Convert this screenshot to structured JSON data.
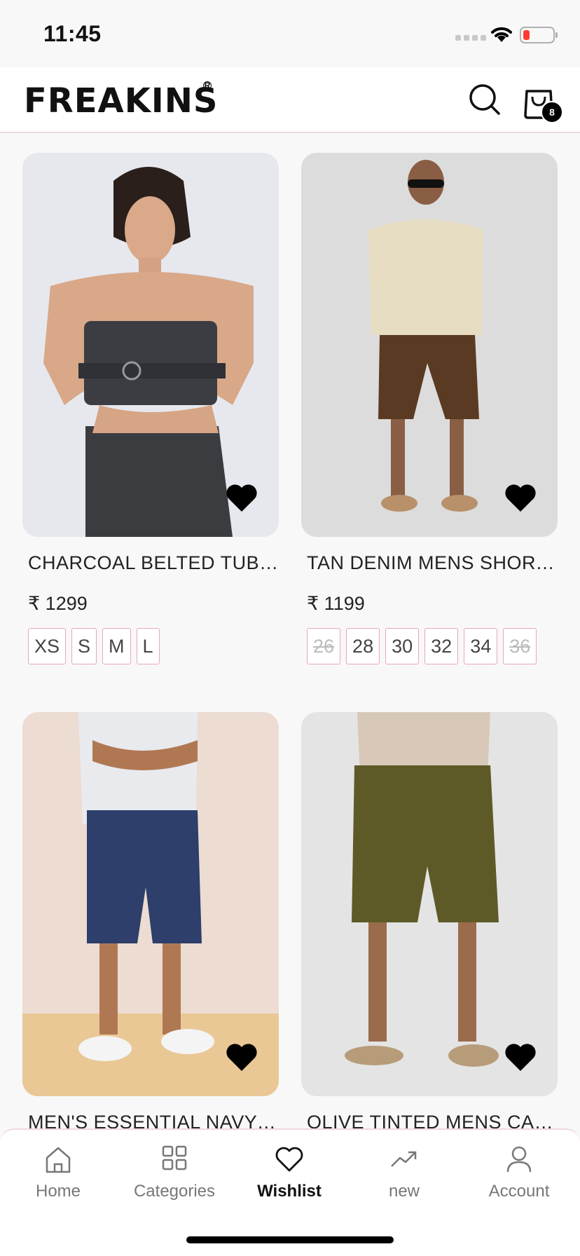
{
  "status_bar": {
    "time": "11:45"
  },
  "header": {
    "brand": "FREAKINS",
    "registered_mark": "R",
    "search_icon": "search-icon",
    "cart_icon": "shopping-bag-icon",
    "cart_count": "8"
  },
  "products": [
    {
      "name": "CHARCOAL BELTED TUBE...",
      "price": "₹ 1299",
      "sizes": [
        "XS",
        "S",
        "M",
        "L"
      ],
      "wishlisted": true
    },
    {
      "name": "TAN DENIM MENS SHORTS",
      "price": "₹ 1199",
      "sizes": [
        "26",
        "28",
        "30",
        "32",
        "34",
        "36"
      ],
      "unavailable_sizes": [
        "26",
        "36"
      ],
      "wishlisted": true
    },
    {
      "name": "MEN'S ESSENTIAL NAVY B...",
      "wishlisted": true
    },
    {
      "name": "OLIVE TINTED MENS CAR...",
      "wishlisted": true
    }
  ],
  "bottom_nav": {
    "items": [
      {
        "label": "Home",
        "icon": "home-icon"
      },
      {
        "label": "Categories",
        "icon": "grid-icon"
      },
      {
        "label": "Wishlist",
        "icon": "heart-icon",
        "active": true
      },
      {
        "label": "new",
        "icon": "trending-up-icon"
      },
      {
        "label": "Account",
        "icon": "user-icon"
      }
    ]
  },
  "colors": {
    "accent_border": "#e8a8b4",
    "battery_low": "#ff3b30"
  }
}
